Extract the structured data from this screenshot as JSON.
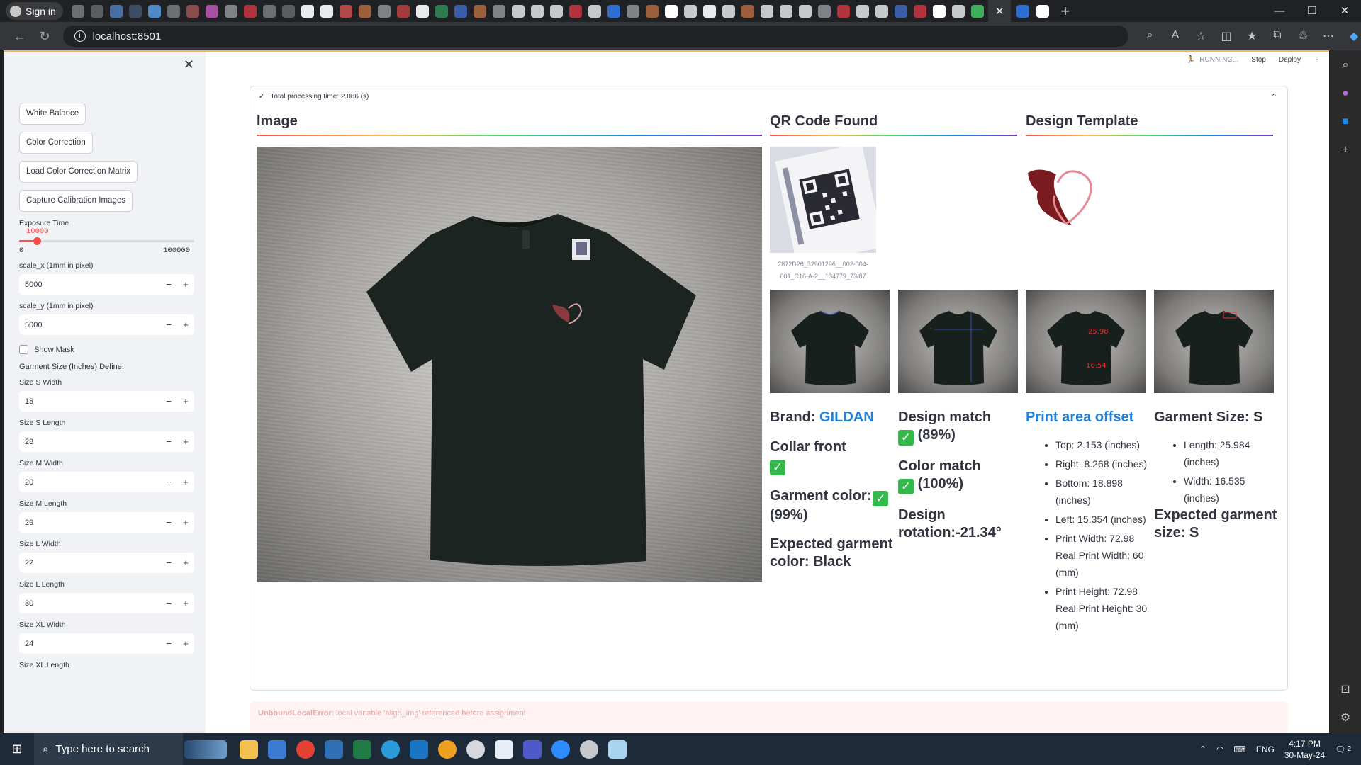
{
  "browser": {
    "signin_label": "Sign in",
    "url": "localhost:8501",
    "new_tab": "+"
  },
  "app": {
    "status": "RUNNING...",
    "stop_label": "Stop",
    "deploy_label": "Deploy"
  },
  "sidebar": {
    "buttons": [
      "White Balance",
      "Color Correction",
      "Load Color Correction Matrix",
      "Capture Calibration Images"
    ],
    "exposure": {
      "label": "Exposure Time",
      "value": "10000",
      "min": "0",
      "max": "100000",
      "fraction": 0.1
    },
    "scale_x": {
      "label": "scale_x (1mm in pixel)",
      "value": "5000"
    },
    "scale_y": {
      "label": "scale_y (1mm in pixel)",
      "value": "5000"
    },
    "show_mask": "Show Mask",
    "size_header": "Garment Size (Inches) Define:",
    "sizes": [
      {
        "label": "Size S Width",
        "value": "18"
      },
      {
        "label": "Size S Length",
        "value": "28"
      },
      {
        "label": "Size M Width",
        "value": "20"
      },
      {
        "label": "Size M Length",
        "value": "29"
      },
      {
        "label": "Size L Width",
        "value": "22"
      },
      {
        "label": "Size L Length",
        "value": "30"
      },
      {
        "label": "Size XL Width",
        "value": "24"
      }
    ],
    "last_label": "Size XL Length",
    "minus": "−",
    "plus": "+"
  },
  "result": {
    "processing_time": "Total processing time: 2.086 (s)",
    "image_header": "Image",
    "qr_header": "QR Code Found",
    "design_header": "Design Template",
    "qr_caption": "2872D26_32901296__002-004-001_C16-A-2__134779_73/87",
    "brand_prefix": "Brand: ",
    "brand": "GILDAN",
    "collar_front": "Collar front",
    "garment_color": "Garment color:",
    "garment_color_pct": "(99%)",
    "expected_color": "Expected garment color: Black",
    "design_match": "Design match",
    "design_match_pct": "(89%)",
    "color_match": "Color match",
    "color_match_pct": "(100%)",
    "design_rotation": "Design rotation:-21.34°",
    "offset_header": "Print area offset",
    "offsets": [
      "Top: 2.153 (inches)",
      "Right: 8.268 (inches)",
      "Bottom: 18.898 (inches)",
      "Left: 15.354 (inches)",
      "Print Width: 72.98 Real Print Width: 60 (mm)",
      "Print Height: 72.98 Real Print Height: 30 (mm)"
    ],
    "garment_size_header": "Garment Size: S",
    "garment_dims": [
      "Length: 25.984 (inches)",
      "Width: 16.535 (inches)"
    ],
    "expected_size": "Expected garment size: S",
    "thumb_labels": [
      "25.98",
      "16.54"
    ]
  },
  "error": {
    "type": "UnboundLocalError",
    "message": ": local variable 'align_img' referenced before assignment"
  },
  "taskbar": {
    "search_placeholder": "Type here to search",
    "lang": "ENG",
    "time": "4:17 PM",
    "date": "30-May-24",
    "notifications": "2"
  },
  "colors": {
    "accent": "#ff4b4b",
    "link": "#1c83e1",
    "check": "#33b84a"
  }
}
